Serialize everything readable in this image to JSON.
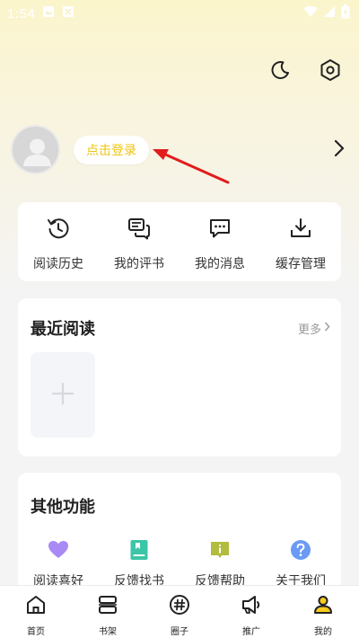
{
  "status_bar": {
    "time": "1:54",
    "battery": "↑"
  },
  "profile": {
    "login_label": "点击登录"
  },
  "quick_actions": [
    {
      "label": "阅读历史",
      "icon": "history-icon"
    },
    {
      "label": "我的评书",
      "icon": "review-icon"
    },
    {
      "label": "我的消息",
      "icon": "message-icon"
    },
    {
      "label": "缓存管理",
      "icon": "download-icon"
    }
  ],
  "recent": {
    "title": "最近阅读",
    "more_label": "更多"
  },
  "other": {
    "title": "其他功能",
    "items": [
      {
        "label": "阅读喜好",
        "icon": "heart-icon",
        "color": "#a98af5"
      },
      {
        "label": "反馈找书",
        "icon": "book-icon",
        "color": "#3cc6a8"
      },
      {
        "label": "反馈帮助",
        "icon": "info-icon",
        "color": "#b2bc3e"
      },
      {
        "label": "关于我们",
        "icon": "question-icon",
        "color": "#6b9af5"
      }
    ]
  },
  "tabs": [
    {
      "label": "首页",
      "icon": "home-icon"
    },
    {
      "label": "书架",
      "icon": "bookshelf-icon"
    },
    {
      "label": "圈子",
      "icon": "hashtag-icon"
    },
    {
      "label": "推广",
      "icon": "megaphone-icon"
    },
    {
      "label": "我的",
      "icon": "user-icon",
      "active": true
    }
  ],
  "colors": {
    "accent": "#f7cb1c",
    "login_text": "#f0c40e",
    "annotation": "#e11d1d"
  }
}
